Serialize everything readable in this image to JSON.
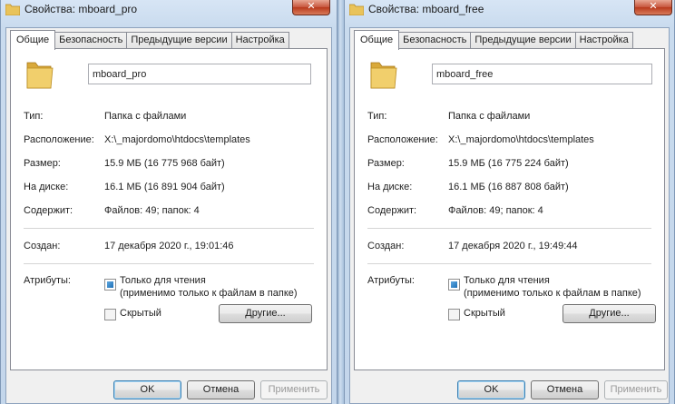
{
  "windows": [
    {
      "title": "Свойства: mboard_pro",
      "close_glyph": "✕",
      "tabs": [
        "Общие",
        "Безопасность",
        "Предыдущие версии",
        "Настройка"
      ],
      "name_value": "mboard_pro",
      "fields": {
        "type_label": "Тип:",
        "type_value": "Папка с файлами",
        "location_label": "Расположение:",
        "location_value": "X:\\_majordomo\\htdocs\\templates",
        "size_label": "Размер:",
        "size_value": "15.9 МБ (16 775 968 байт)",
        "ondisk_label": "На диске:",
        "ondisk_value": "16.1 МБ (16 891 904 байт)",
        "contains_label": "Содержит:",
        "contains_value": "Файлов: 49; папок: 4",
        "created_label": "Создан:",
        "created_value": "17 декабря 2020 г., 19:01:46",
        "attributes_label": "Атрибуты:"
      },
      "readonly_label": "Только для чтения",
      "readonly_note": "(применимо только к файлам в папке)",
      "hidden_label": "Скрытый",
      "other_button": "Другие...",
      "ok": "OK",
      "cancel": "Отмена",
      "apply": "Применить"
    },
    {
      "title": "Свойства: mboard_free",
      "close_glyph": "✕",
      "tabs": [
        "Общие",
        "Безопасность",
        "Предыдущие версии",
        "Настройка"
      ],
      "name_value": "mboard_free",
      "fields": {
        "type_label": "Тип:",
        "type_value": "Папка с файлами",
        "location_label": "Расположение:",
        "location_value": "X:\\_majordomo\\htdocs\\templates",
        "size_label": "Размер:",
        "size_value": "15.9 МБ (16 775 224 байт)",
        "ondisk_label": "На диске:",
        "ondisk_value": "16.1 МБ (16 887 808 байт)",
        "contains_label": "Содержит:",
        "contains_value": "Файлов: 49; папок: 4",
        "created_label": "Создан:",
        "created_value": "17 декабря 2020 г., 19:49:44",
        "attributes_label": "Атрибуты:"
      },
      "readonly_label": "Только для чтения",
      "readonly_note": "(применимо только к файлам в папке)",
      "hidden_label": "Скрытый",
      "other_button": "Другие...",
      "ok": "OK",
      "cancel": "Отмена",
      "apply": "Применить"
    }
  ],
  "colors": {
    "folder": "#e9c35a",
    "accent": "#3c7fb1",
    "close": "#c7553b"
  }
}
